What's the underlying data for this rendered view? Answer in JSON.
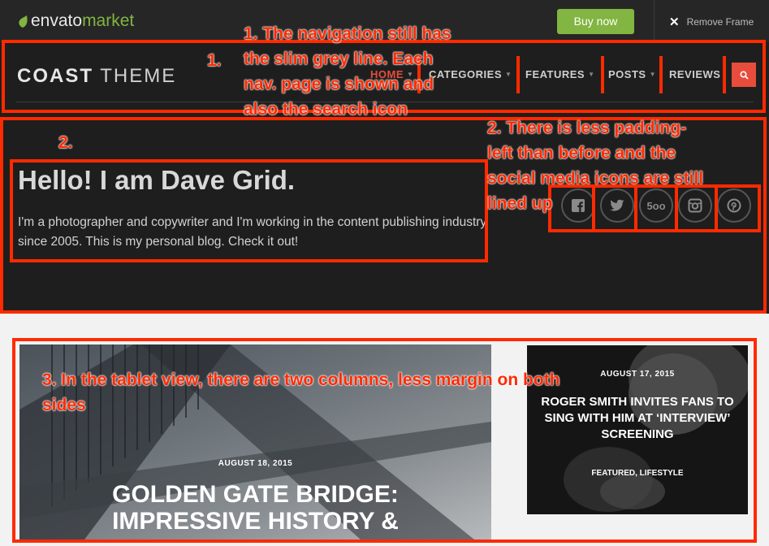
{
  "envato_bar": {
    "logo_envato": "envato",
    "logo_market": "market",
    "buy_label": "Buy now",
    "remove_frame_label": "Remove Frame"
  },
  "site": {
    "logo_bold": "COAST",
    "logo_thin": "THEME",
    "nav": [
      {
        "label": "HOME",
        "active": true
      },
      {
        "label": "CATEGORIES",
        "active": false
      },
      {
        "label": "FEATURES",
        "active": false
      },
      {
        "label": "POSTS",
        "active": false
      },
      {
        "label": "REVIEWS",
        "active": false
      }
    ],
    "search_icon": "search-icon"
  },
  "hero": {
    "title": "Hello! I am Dave Grid.",
    "text": "I'm a photographer and copywriter and I'm working in the content publishing industry since 2005. This is my personal blog. Check it out!",
    "social": [
      {
        "name": "facebook-icon",
        "glyph": "f"
      },
      {
        "name": "twitter-icon",
        "glyph": "t"
      },
      {
        "name": "500px-icon",
        "glyph": "5oo"
      },
      {
        "name": "instagram-icon",
        "glyph": "◎"
      },
      {
        "name": "pinterest-icon",
        "glyph": "p"
      }
    ]
  },
  "posts": [
    {
      "date": "AUGUST 18, 2015",
      "title_line1": "GOLDEN GATE BRIDGE:",
      "title_line2": "IMPRESSIVE HISTORY &"
    },
    {
      "date": "AUGUST 17, 2015",
      "title": "ROGER SMITH INVITES FANS TO SING WITH HIM AT ‘INTERVIEW’ SCREENING",
      "categories": "FEATURED, LIFESTYLE"
    }
  ],
  "annotations": {
    "a1_label": "1.",
    "a1_line1": "1. The navigation still has",
    "a1_line2": "the slim grey line. Each",
    "a1_line3": "nav. page is shown and",
    "a1_line4": "also the search icon",
    "a2_label": "2.",
    "a2_line1": "2. There is less padding-",
    "a2_line2": "left than before and the",
    "a2_line3": "social media icons are still",
    "a2_line4": "lined up",
    "a3_line1": "3. In the tablet view, there are two columns, less margin on both",
    "a3_line2": "sides"
  },
  "colors": {
    "accent": "#e74c3c",
    "envato_green": "#82b541",
    "annotation_red": "#ff2a00",
    "header_bg": "#1e1e1e"
  }
}
